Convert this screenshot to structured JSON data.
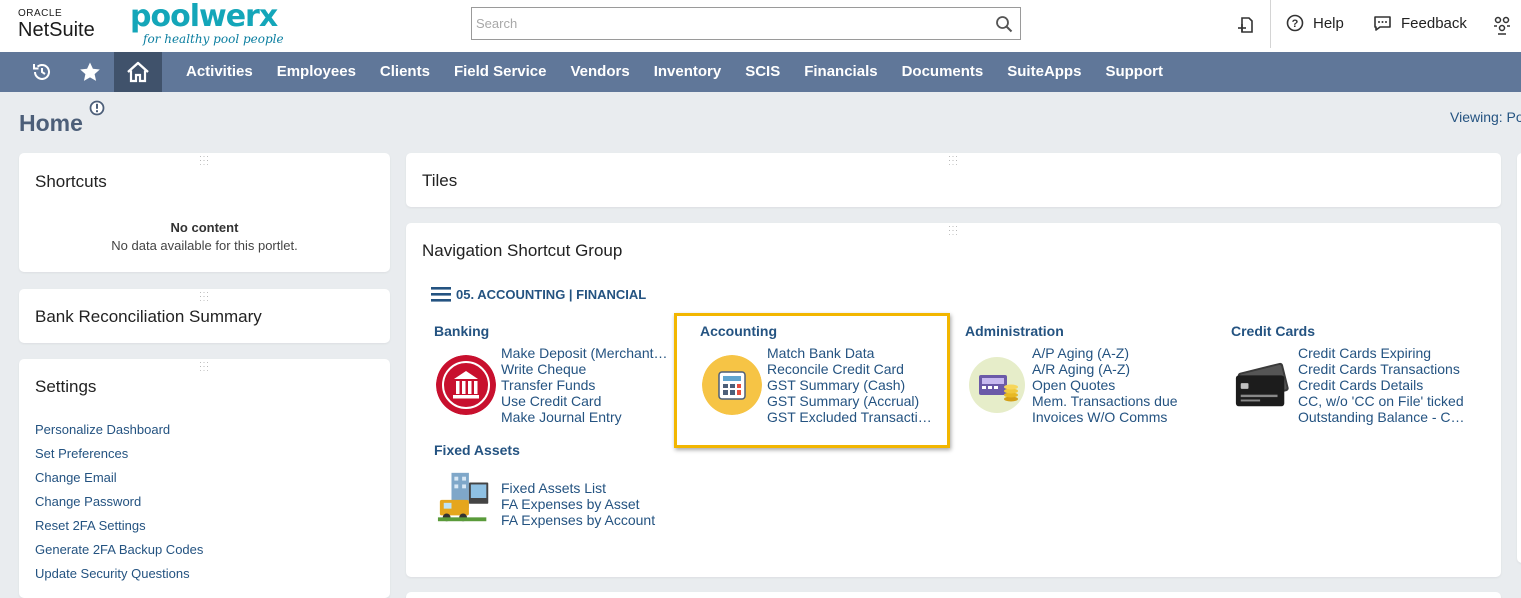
{
  "header": {
    "oracle_label": "ORACLE",
    "netsuite_label": "NetSuite",
    "brand_name": "poolwerx",
    "brand_tagline": "for healthy pool people",
    "search_placeholder": "Search",
    "help_label": "Help",
    "feedback_label": "Feedback"
  },
  "nav": {
    "items": [
      "Activities",
      "Employees",
      "Clients",
      "Field Service",
      "Vendors",
      "Inventory",
      "SCIS",
      "Financials",
      "Documents",
      "SuiteApps",
      "Support"
    ]
  },
  "page": {
    "title": "Home",
    "viewing": "Viewing: Po"
  },
  "shortcuts": {
    "title": "Shortcuts",
    "empty_title": "No content",
    "empty_sub": "No data available for this portlet."
  },
  "bank_rec": {
    "title": "Bank Reconciliation Summary"
  },
  "settings": {
    "title": "Settings",
    "links": [
      "Personalize Dashboard",
      "Set Preferences",
      "Change Email",
      "Change Password",
      "Reset 2FA Settings",
      "Generate 2FA Backup Codes",
      "Update Security Questions"
    ]
  },
  "tiles": {
    "title": "Tiles"
  },
  "nav_group": {
    "title": "Navigation Shortcut Group",
    "group_name": "05. ACCOUNTING | FINANCIAL",
    "categories": [
      {
        "title": "Banking",
        "links": [
          "Make Deposit (Merchant…",
          "Write Cheque",
          "Transfer Funds",
          "Use Credit Card",
          "Make Journal Entry"
        ]
      },
      {
        "title": "Accounting",
        "links": [
          "Match Bank Data",
          "Reconcile Credit Card",
          "GST Summary (Cash)",
          "GST Summary (Accrual)",
          "GST Excluded Transacti…"
        ]
      },
      {
        "title": "Administration",
        "links": [
          "A/P Aging (A-Z)",
          "A/R Aging (A-Z)",
          "Open Quotes",
          "Mem. Transactions due",
          "Invoices W/O Comms"
        ]
      },
      {
        "title": "Credit Cards",
        "links": [
          "Credit Cards Expiring",
          "Credit Cards Transactions",
          "Credit Cards Details",
          "CC, w/o 'CC on File' ticked",
          "Outstanding Balance - C…"
        ]
      },
      {
        "title": "Fixed Assets",
        "links": [
          "Fixed Assets List",
          "FA Expenses by Asset",
          "FA Expenses by Account"
        ]
      }
    ]
  },
  "colors": {
    "nav_bg": "#607799",
    "nav_active": "#40526b",
    "link": "#245381",
    "highlight": "#f2b600",
    "banking_icon": "#c8102e",
    "accounting_icon": "#f6c445"
  }
}
